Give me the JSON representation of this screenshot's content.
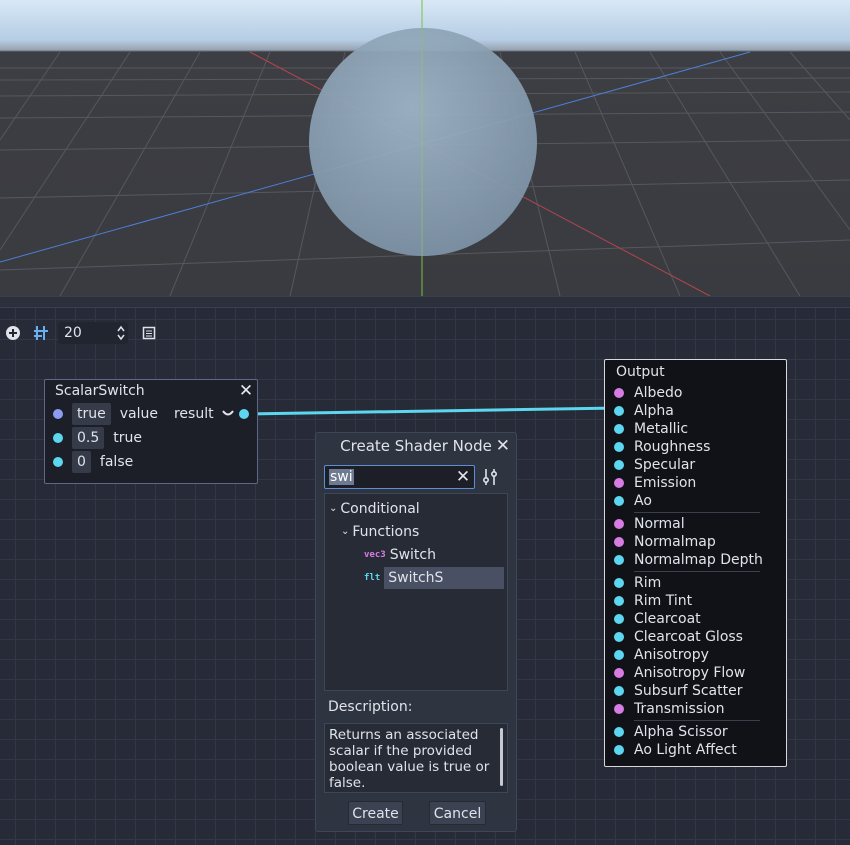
{
  "toolbar": {
    "add_icon": "plus-circle-icon",
    "snap_icon": "grid-snap-icon",
    "zoom_value": "20",
    "spin_icon": "updown-icon",
    "doc_icon": "document-icon"
  },
  "scalar_switch": {
    "title": "ScalarSwitch",
    "rows": [
      {
        "value": "true",
        "label": "value",
        "out_label": "result"
      },
      {
        "value": "0.5",
        "label": "true"
      },
      {
        "value": "0",
        "label": "false"
      }
    ]
  },
  "output": {
    "title": "Output",
    "groups": [
      [
        {
          "label": "Albedo",
          "color": "#d77ce3"
        },
        {
          "label": "Alpha",
          "color": "#5dd6f0"
        },
        {
          "label": "Metallic",
          "color": "#5dd6f0"
        },
        {
          "label": "Roughness",
          "color": "#5dd6f0"
        },
        {
          "label": "Specular",
          "color": "#5dd6f0"
        },
        {
          "label": "Emission",
          "color": "#d77ce3"
        },
        {
          "label": "Ao",
          "color": "#5dd6f0"
        }
      ],
      [
        {
          "label": "Normal",
          "color": "#d77ce3"
        },
        {
          "label": "Normalmap",
          "color": "#d77ce3"
        },
        {
          "label": "Normalmap Depth",
          "color": "#5dd6f0"
        }
      ],
      [
        {
          "label": "Rim",
          "color": "#5dd6f0"
        },
        {
          "label": "Rim Tint",
          "color": "#5dd6f0"
        },
        {
          "label": "Clearcoat",
          "color": "#5dd6f0"
        },
        {
          "label": "Clearcoat Gloss",
          "color": "#5dd6f0"
        },
        {
          "label": "Anisotropy",
          "color": "#5dd6f0"
        },
        {
          "label": "Anisotropy Flow",
          "color": "#d77ce3"
        },
        {
          "label": "Subsurf Scatter",
          "color": "#5dd6f0"
        },
        {
          "label": "Transmission",
          "color": "#d77ce3"
        }
      ],
      [
        {
          "label": "Alpha Scissor",
          "color": "#5dd6f0"
        },
        {
          "label": "Ao Light Affect",
          "color": "#5dd6f0"
        }
      ]
    ]
  },
  "dialog": {
    "title": "Create Shader Node",
    "search_value": "swi",
    "tree": {
      "category": "Conditional",
      "subcategory": "Functions",
      "items": [
        {
          "badge": "vec3",
          "label": "Switch"
        },
        {
          "badge": "flt",
          "label": "SwitchS"
        }
      ]
    },
    "description_label": "Description:",
    "description": "Returns an associated scalar if the provided boolean value is true or false.",
    "create_label": "Create",
    "cancel_label": "Cancel"
  },
  "colors": {
    "vector_port": "#d77ce3",
    "scalar_port": "#5dd6f0",
    "boolean_port": "#8d9cf2",
    "accent": "#67b1f0"
  }
}
